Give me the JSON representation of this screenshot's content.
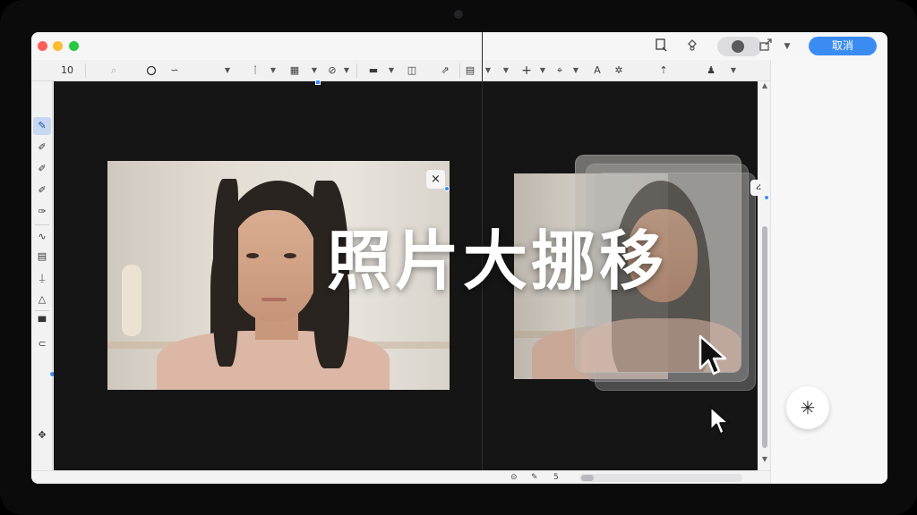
{
  "toolbar": {
    "zoom_value": "10",
    "cancel_label": "取消"
  },
  "overlay": {
    "headline": "照片大挪移"
  },
  "canvas": {
    "left_close_glyph": "×",
    "right_close_glyph": "ረ"
  },
  "statusbar": {
    "page_number": "5"
  },
  "colors": {
    "accent": "#3b8cf2",
    "canvas_background": "#151516",
    "window_background": "#f3f3f4"
  },
  "icons": {
    "titlebar": [
      "document-crop-icon",
      "hand-pointer-icon",
      "record-icon",
      "share-icon",
      "chevron-down-icon"
    ],
    "toolbar": [
      "search-icon",
      "lasso-icon",
      "link-icon",
      "brush-icon",
      "crop-icon",
      "layers-icon",
      "align-icon",
      "frame-icon",
      "transform-icon",
      "image-icon",
      "add-icon",
      "pen-icon",
      "text-icon",
      "settings-icon",
      "export-icon",
      "user-icon"
    ],
    "sidebar": [
      "pen-tool-icon",
      "brush-tool-icon",
      "pencil-tool-icon",
      "marker-tool-icon",
      "eraser-tool-icon",
      "lasso-tool-icon",
      "image-tool-icon",
      "stamp-tool-icon",
      "shape-tool-icon",
      "folder-icon",
      "link-tool-icon",
      "settings-tool-icon"
    ],
    "fab": "sparkle-icon"
  }
}
